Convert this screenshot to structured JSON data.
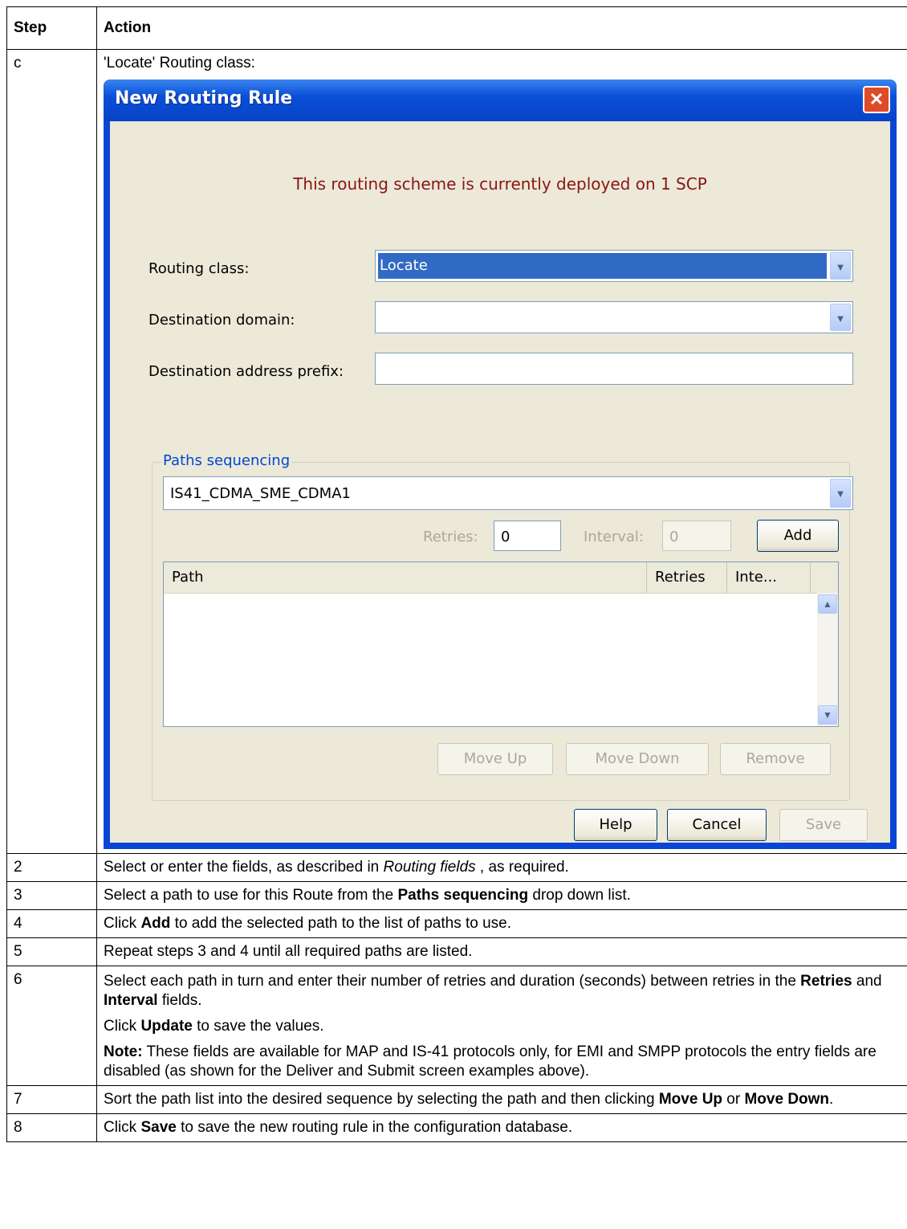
{
  "table": {
    "header": {
      "step": "Step",
      "action": "Action"
    },
    "row_c": {
      "step": "c",
      "caption": "'Locate' Routing class:"
    },
    "rows": [
      {
        "step": "2",
        "text": [
          "Select or enter the fields, as described in ",
          "Routing fields",
          " , as required."
        ]
      },
      {
        "step": "3",
        "text": [
          "Select a path to use for this Route from the ",
          "Paths sequencing",
          " drop down list."
        ]
      },
      {
        "step": "4",
        "text": [
          "Click ",
          "Add",
          " to add the selected path to the list of paths to use."
        ]
      },
      {
        "step": "5",
        "text": [
          "Repeat steps 3 and 4 until all required paths are listed."
        ]
      },
      {
        "step": "6",
        "p1": [
          "Select each path in turn and enter their number of retries and duration (seconds) between retries in the ",
          "Retries",
          " and ",
          "Interval",
          " fields."
        ],
        "p2": [
          "Click ",
          "Update",
          " to save the values."
        ],
        "p3": [
          "Note:",
          " These fields are available for MAP and IS-41 protocols only, for EMI and SMPP protocols the entry fields are disabled (as shown for the Deliver and Submit screen examples above)."
        ]
      },
      {
        "step": "7",
        "text": [
          "Sort the path list into the desired sequence by selecting the path and then clicking ",
          "Move Up",
          " or ",
          "Move Down",
          "."
        ]
      },
      {
        "step": "8",
        "text": [
          "Click ",
          "Save",
          " to save the new routing rule in the configuration database."
        ]
      }
    ]
  },
  "dialog": {
    "title": "New Routing Rule",
    "close_glyph": "✕",
    "deployed_message": "This routing scheme is currently deployed on 1 SCP",
    "routing_class_label": "Routing class:",
    "routing_class_value": "Locate",
    "destination_domain_label": "Destination domain:",
    "destination_domain_value": "",
    "destination_prefix_label": "Destination address prefix:",
    "destination_prefix_value": "",
    "paths_group_title": "Paths sequencing",
    "path_select_value": "IS41_CDMA_SME_CDMA1",
    "retries_label": "Retries:",
    "retries_value": "0",
    "interval_label": "Interval:",
    "interval_value": "0",
    "add_button": "Add",
    "columns": [
      "Path",
      "Retries",
      "Inte..."
    ],
    "move_up_button": "Move Up",
    "move_down_button": "Move Down",
    "remove_button": "Remove",
    "help_button": "Help",
    "cancel_button": "Cancel",
    "save_button": "Save"
  },
  "icons": {
    "dropdown": "chevron-down-icon",
    "scroll_up": "chevron-up-icon",
    "close": "close-icon"
  }
}
